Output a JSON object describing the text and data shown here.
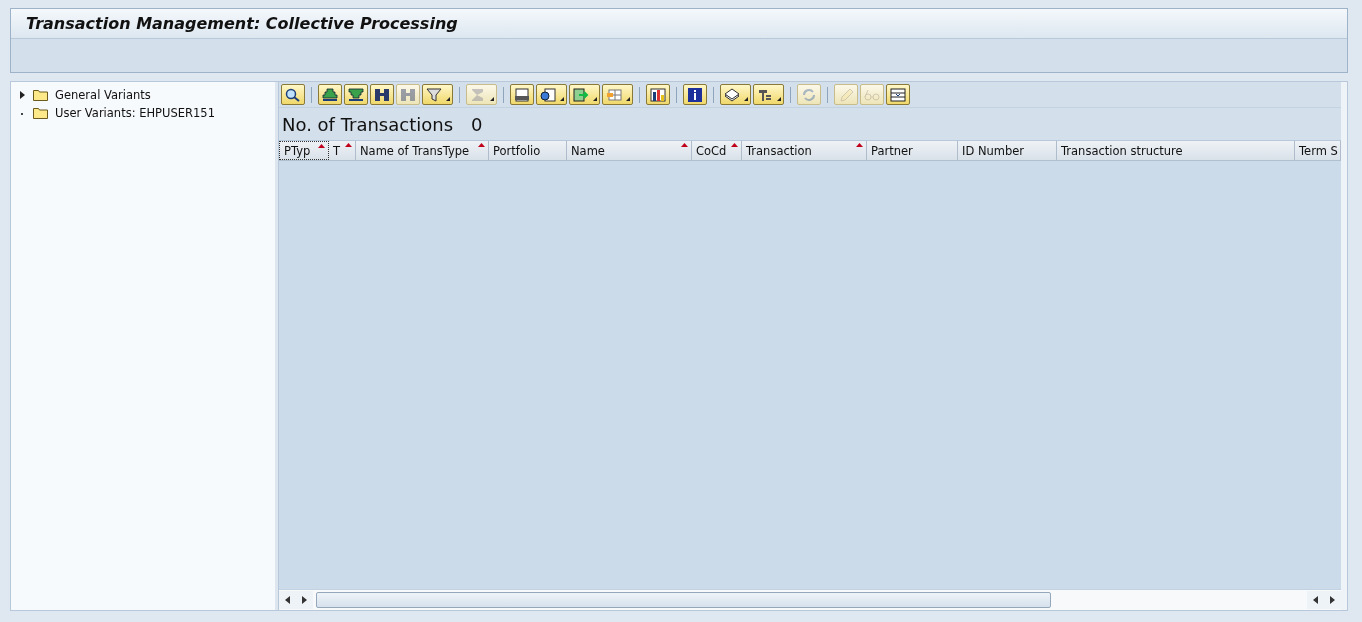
{
  "window": {
    "title": "Transaction Management: Collective Processing"
  },
  "tree": {
    "items": [
      {
        "label": "General Variants",
        "has_children": true
      },
      {
        "label": "User Variants: EHPUSER151",
        "has_children": false
      }
    ]
  },
  "toolbar": {
    "groups": [
      [
        {
          "dropdown": false,
          "disabled": false
        }
      ],
      [
        {
          "dropdown": false,
          "disabled": false
        },
        {
          "dropdown": false,
          "disabled": false
        },
        {
          "dropdown": false,
          "disabled": false
        },
        {
          "dropdown": false,
          "disabled": true
        },
        {
          "dropdown": true,
          "disabled": false
        }
      ],
      [
        {
          "dropdown": true,
          "disabled": true
        }
      ],
      [
        {
          "dropdown": false,
          "disabled": false
        },
        {
          "dropdown": true,
          "disabled": false
        },
        {
          "dropdown": true,
          "disabled": false
        },
        {
          "dropdown": true,
          "disabled": false
        }
      ],
      [
        {
          "dropdown": false,
          "disabled": false
        }
      ],
      [
        {
          "dropdown": false,
          "disabled": false
        }
      ],
      [
        {
          "dropdown": true,
          "disabled": false
        },
        {
          "dropdown": true,
          "disabled": false
        }
      ],
      [
        {
          "dropdown": false,
          "disabled": true
        }
      ],
      [
        {
          "dropdown": false,
          "disabled": true
        },
        {
          "dropdown": false,
          "disabled": true
        },
        {
          "dropdown": false,
          "disabled": false
        }
      ]
    ]
  },
  "grid": {
    "title": "No. of Transactions",
    "count": "0",
    "columns": [
      {
        "label": "PTyp",
        "sorted": true
      },
      {
        "label": "T",
        "sorted": true
      },
      {
        "label": "Name of TransType",
        "sorted": true
      },
      {
        "label": "Portfolio",
        "sorted": false
      },
      {
        "label": "Name",
        "sorted": true
      },
      {
        "label": "CoCd",
        "sorted": true
      },
      {
        "label": "Transaction",
        "sorted": true
      },
      {
        "label": "Partner",
        "sorted": false
      },
      {
        "label": "ID Number",
        "sorted": false
      },
      {
        "label": "Transaction structure",
        "sorted": false
      },
      {
        "label": "Term S",
        "sorted": false
      }
    ]
  }
}
